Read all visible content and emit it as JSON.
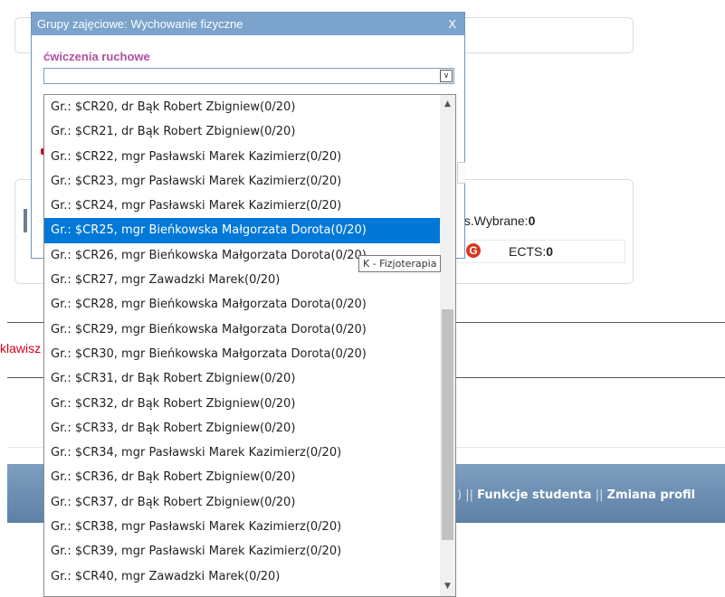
{
  "dialog": {
    "title": "Grupy zajęciowe: Wychowanie fizyczne",
    "close": "X",
    "section_label": "ćwiczenia ruchowe",
    "select_value": ""
  },
  "options": [
    "Gr.: $CR20, dr Bąk Robert Zbigniew(0/20)",
    "Gr.: $CR21, dr Bąk Robert Zbigniew(0/20)",
    "Gr.: $CR22, mgr Pasławski Marek Kazimierz(0/20)",
    "Gr.: $CR23, mgr Pasławski Marek Kazimierz(0/20)",
    "Gr.: $CR24, mgr Pasławski Marek Kazimierz(0/20)",
    "Gr.: $CR25, mgr Bieńkowska Małgorzata Dorota(0/20)",
    "Gr.: $CR26, mgr Bieńkowska Małgorzata Dorota(0/20)",
    "Gr.: $CR27, mgr Zawadzki Marek(0/20)",
    "Gr.: $CR28, mgr Bieńkowska Małgorzata Dorota(0/20)",
    "Gr.: $CR29, mgr Bieńkowska Małgorzata Dorota(0/20)",
    "Gr.: $CR30, mgr Bieńkowska Małgorzata Dorota(0/20)",
    "Gr.: $CR31, dr Bąk Robert Zbigniew(0/20)",
    "Gr.: $CR32, dr Bąk Robert Zbigniew(0/20)",
    "Gr.: $CR33, dr Bąk Robert Zbigniew(0/20)",
    "Gr.: $CR34, mgr Pasławski Marek Kazimierz(0/20)",
    "Gr.: $CR36, dr Bąk Robert Zbigniew(0/20)",
    "Gr.: $CR37, dr Bąk Robert Zbigniew(0/20)",
    "Gr.: $CR38, mgr Pasławski Marek Kazimierz(0/20)",
    "Gr.: $CR39, mgr Pasławski Marek Kazimierz(0/20)",
    "Gr.: $CR40, mgr Zawadzki Marek(0/20)"
  ],
  "selected_option": "Gr.: $CR25, mgr Bieńkowska Małgorzata Dorota(0/20)",
  "tooltip": "K - Fizjoterapia",
  "background": {
    "ects_wybrane_label": "ts.Wybrane:",
    "ects_wybrane_value": "0",
    "ects_label": "ECTS:",
    "ects_value": "0",
    "g_icon_letter": "G",
    "red_text": "klawisz",
    "footer_sep1": ") || ",
    "footer_link1": "Funkcje studenta",
    "footer_sep2": " || ",
    "footer_link2": "Zmiana profil"
  },
  "icons": {
    "select_arrow": "chevron-down-icon",
    "scroll_up": "scroll-up-arrow-icon",
    "scroll_down": "scroll-down-arrow-icon",
    "g_icon": "g-logo-icon"
  },
  "colors": {
    "title_bar": "#7ba3cc",
    "selection": "#0078d7",
    "section_label": "#b04fa0",
    "red_text": "#d0021b"
  }
}
